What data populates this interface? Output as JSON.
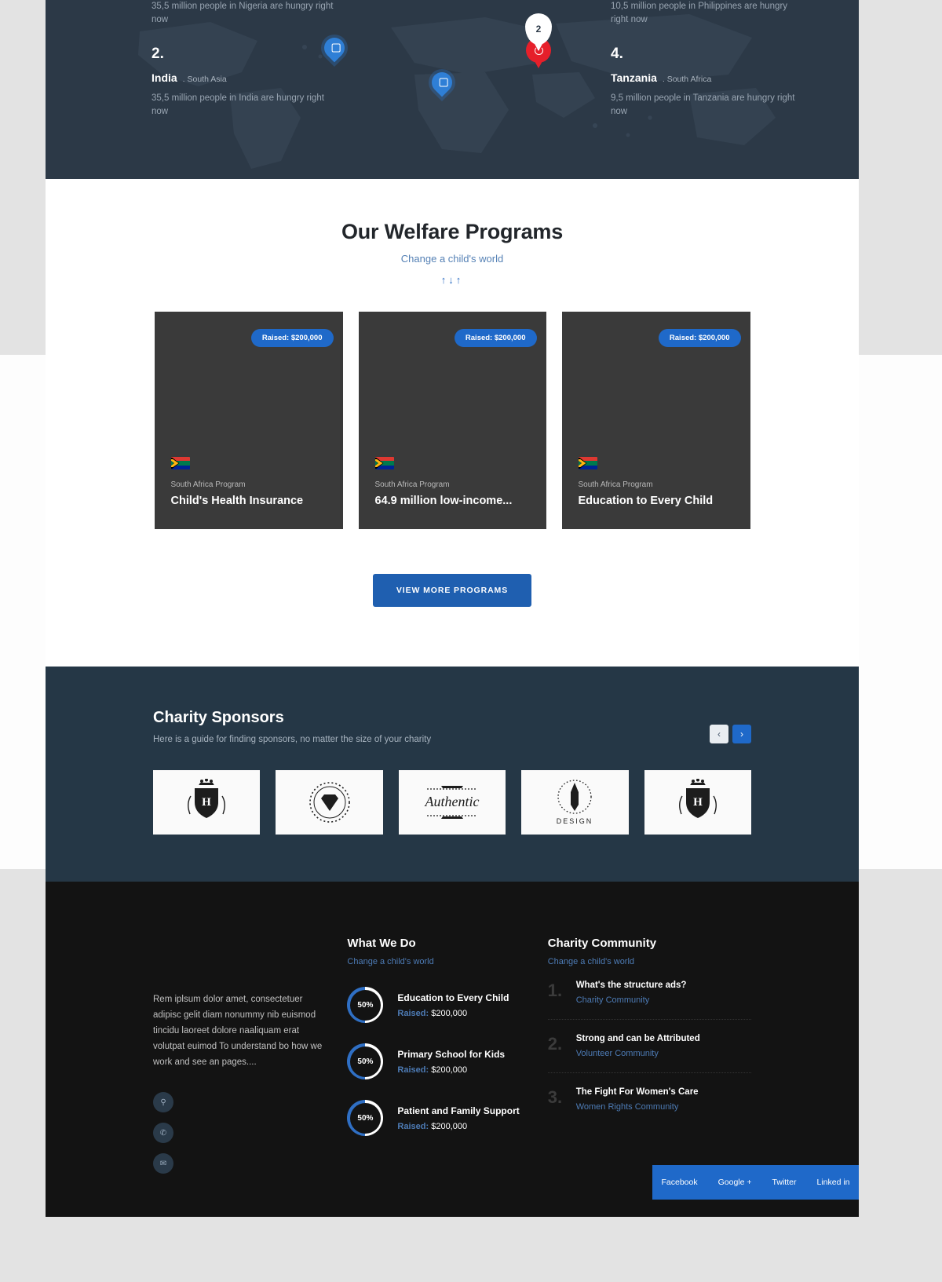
{
  "map": {
    "columns": [
      {
        "id": "nigeria",
        "rank": "",
        "country": "",
        "region": "",
        "desc": "35,5 million people in Nigeria are hungry right now"
      },
      {
        "id": "india",
        "rank": "2.",
        "country": "India",
        "region": ". South Asia",
        "desc": "35,5 million people in India are hungry right now"
      },
      {
        "id": "philippines",
        "rank": "",
        "country": "",
        "region": "",
        "desc": "10,5 million people in Philippines are hungry right now"
      },
      {
        "id": "tanzania",
        "rank": "4.",
        "country": "Tanzania",
        "region": ". South Africa",
        "desc": "9,5 million people in Tanzania are hungry right now"
      }
    ],
    "active_pin_label": "2"
  },
  "programs": {
    "title": "Our Welfare Programs",
    "subtitle": "Change a child's world",
    "arrows": "↑↓↑",
    "cards": [
      {
        "badge": "Raised: $200,000",
        "kicker": "South Africa Program",
        "title": "Child's Health Insurance"
      },
      {
        "badge": "Raised: $200,000",
        "kicker": "South Africa Program",
        "title": "64.9 million low-income..."
      },
      {
        "badge": "Raised: $200,000",
        "kicker": "South Africa Program",
        "title": "Education to Every Child"
      }
    ],
    "cta_label": "VIEW MORE PROGRAMS"
  },
  "sponsors": {
    "title": "Charity Sponsors",
    "subtitle": "Here is a guide for finding sponsors, no matter the size of your charity",
    "prev_label": "‹",
    "next_label": "›",
    "logos": [
      {
        "name": "crest-h-logo",
        "mark": "H",
        "caption": ""
      },
      {
        "name": "diamond-badge-logo",
        "mark": "◆",
        "caption": ""
      },
      {
        "name": "authentic-script-logo",
        "mark": "Authentic",
        "caption": ""
      },
      {
        "name": "pencil-design-logo",
        "mark": "✎",
        "caption": "DESIGN"
      },
      {
        "name": "crest-h-logo-alt",
        "mark": "H",
        "caption": ""
      }
    ]
  },
  "footer": {
    "about_text": "Rem iplsum dolor amet, consectetuer adipisc gelit diam nonummy nib euismod tincidu laoreet dolore naaliquam erat volutpat euimod To understand bo how we work and see an pages....",
    "social_icons": [
      {
        "name": "location-icon",
        "glyph": "⚲"
      },
      {
        "name": "phone-icon",
        "glyph": "✆"
      },
      {
        "name": "mail-icon",
        "glyph": "✉"
      }
    ],
    "what_we_do": {
      "heading": "What We Do",
      "subheading": "Change a child's world",
      "items": [
        {
          "percent": "50%",
          "title": "Education to Every Child",
          "raised_label": "Raised:",
          "raised_value": " $200,000"
        },
        {
          "percent": "50%",
          "title": "Primary School for Kids",
          "raised_label": "Raised:",
          "raised_value": " $200,000"
        },
        {
          "percent": "50%",
          "title": "Patient and Family Support",
          "raised_label": "Raised:",
          "raised_value": " $200,000"
        }
      ]
    },
    "charity_community": {
      "heading": "Charity Community",
      "subheading": "Change a child's world",
      "items": [
        {
          "num": "1.",
          "title": "What's the structure ads?",
          "sub": "Charity Community"
        },
        {
          "num": "2.",
          "title": "Strong and can be Attributed",
          "sub": "Volunteer Community"
        },
        {
          "num": "3.",
          "title": "The Fight For Women's Care",
          "sub": "Women Rights Community"
        }
      ]
    },
    "social_links": [
      {
        "label": "Facebook"
      },
      {
        "label": "Google +"
      },
      {
        "label": "Twitter"
      },
      {
        "label": "Linked in"
      }
    ]
  },
  "colors": {
    "accent_blue": "#1f69c9",
    "dark_navy": "#253746",
    "map_navy": "#2c3947",
    "card_gray": "#3a3a3a",
    "footer_black": "#131313",
    "link_blue": "#4d7bb5"
  }
}
